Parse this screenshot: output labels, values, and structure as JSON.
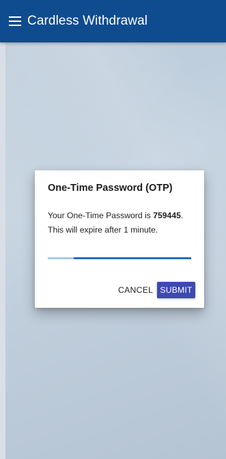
{
  "appbar": {
    "title": "Cardless Withdrawal",
    "menu_icon": "hamburger-menu-icon",
    "background_color": "#0f4c8f"
  },
  "otp_dialog": {
    "title": "One-Time Password (OTP)",
    "message_prefix": "Your One-Time Password is ",
    "otp_code": "759445",
    "message_suffix": ".",
    "expiry_text": "This will expire after 1 minute.",
    "time_remaining_fraction": 0.82,
    "cancel_label": "CANCEL",
    "submit_label": "SUBMIT",
    "submit_color": "#3d49b0",
    "progress_color": "#1f6fc4",
    "progress_track_color": "#a9c9ec"
  }
}
